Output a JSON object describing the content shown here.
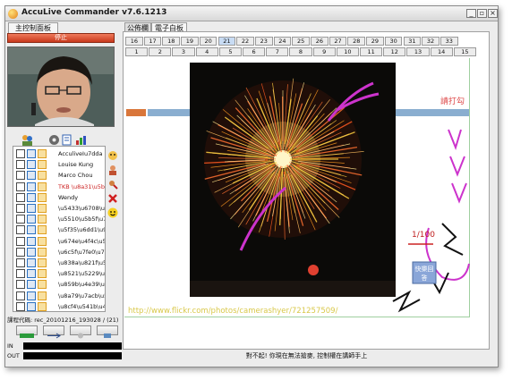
{
  "window": {
    "title": "AccuLive Commander v7.6.1213",
    "min_glyph": "_",
    "max_glyph": "▫",
    "close_glyph": "×"
  },
  "left_tabs": [
    {
      "label": "主控制面板"
    }
  ],
  "main_tabs": [
    {
      "label": "公佈欄"
    },
    {
      "label": "電子白板"
    }
  ],
  "stop_button_label": "停止",
  "users": [
    {
      "name": "AcculiveIu7dda",
      "color": "#111111"
    },
    {
      "name": "Louise Kung",
      "color": "#111111"
    },
    {
      "name": "Marco Chou",
      "color": "#111111"
    },
    {
      "name": "TKB \\u8a31\\u5bb",
      "color": "#cc2222"
    },
    {
      "name": "Wendy",
      "color": "#111111"
    },
    {
      "name": "\\u5433\\u6708\\u92",
      "color": "#111111"
    },
    {
      "name": "\\u5510\\u5b5f\\u74",
      "color": "#111111"
    },
    {
      "name": "\\u5f35\\u6dd1\\u93",
      "color": "#111111"
    },
    {
      "name": "\\u674e\\u4f4c\\u5fb",
      "color": "#111111"
    },
    {
      "name": "\\u6c5f\\u7fe0\\u73c",
      "color": "#111111"
    },
    {
      "name": "\\u838a\\u821f\\u52",
      "color": "#111111"
    },
    {
      "name": "\\u8521\\u5229\\u4e",
      "color": "#111111"
    },
    {
      "name": "\\u859b\\u4e39\\u65",
      "color": "#111111"
    },
    {
      "name": "\\u8a79\\u7acb\\u5e",
      "color": "#111111"
    },
    {
      "name": "\\u8cf4\\u541b\\u4e",
      "color": "#111111"
    }
  ],
  "course_code": "課程代碼: rec_20101216_193028 / (21)",
  "meter_in_label": "IN",
  "meter_out_label": "OUT",
  "pages_top": [
    "16",
    "17",
    "18",
    "19",
    "20",
    "21",
    "22",
    "23",
    "24",
    "25",
    "26",
    "27",
    "28",
    "29",
    "30",
    "31",
    "32",
    "33"
  ],
  "pages_bottom": [
    "1",
    "2",
    "3",
    "4",
    "5",
    "6",
    "7",
    "8",
    "9",
    "10",
    "11",
    "12",
    "13",
    "14",
    "15"
  ],
  "active_page": "21",
  "whiteboard": {
    "link_text": "http://www.flickr.com/photos/camerashyer/721257509/",
    "annotation_text": "請打勾",
    "fraction_text": "1/100",
    "sticky_note": "快樂回答"
  },
  "status_text": "對不起! 你現在無法搶麥, 控制權在講師手上",
  "colors": {
    "accent_blue": "#8aaed0",
    "accent_orange": "#d9763a",
    "pen_magenta": "#cc33cc",
    "pen_black": "#111111"
  }
}
